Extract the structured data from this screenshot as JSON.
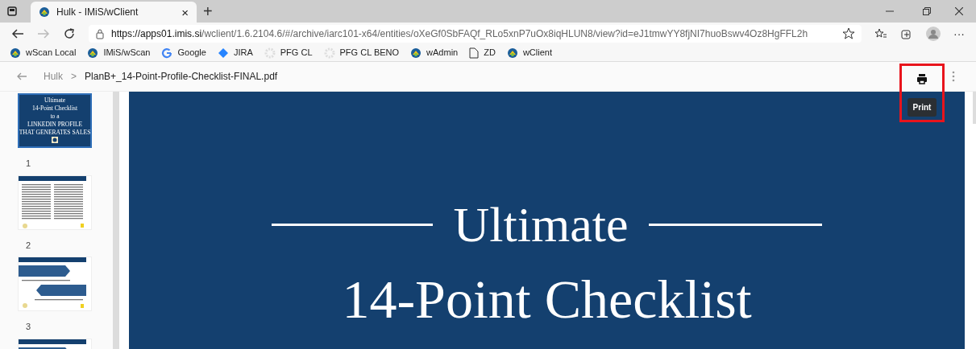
{
  "browser": {
    "tab": {
      "title": "Hulk - IMiS/wClient",
      "close": "×",
      "selected": true
    },
    "new_tab": "+",
    "url_host": "https://apps01.imis.si",
    "url_path": "/wclient/1.6.2104.6/#/archive/iarc101-x64/entities/oXeGf0SbFAQf_RLo5xnP7uOx8iqHLUN8/view?id=eJ1tmwYY8fjNI7huoBswv4Oz8HgFFL2h",
    "menu": "···",
    "bookmarks": [
      {
        "kind": "imis",
        "label": "wScan Local"
      },
      {
        "kind": "imis",
        "label": "IMiS/wScan"
      },
      {
        "kind": "google",
        "label": "Google"
      },
      {
        "kind": "jira",
        "label": "JIRA"
      },
      {
        "kind": "gear",
        "label": "PFG CL"
      },
      {
        "kind": "gear",
        "label": "PFG CL BENO"
      },
      {
        "kind": "imis",
        "label": "wAdmin"
      },
      {
        "kind": "page",
        "label": "ZD"
      },
      {
        "kind": "imis",
        "label": "wClient"
      }
    ]
  },
  "viewer": {
    "breadcrumb": [
      "Hulk",
      "PlanB+_14-Point-Profile-Checklist-FINAL.pdf"
    ],
    "breadcrumb_separator": ">",
    "print_tooltip": "Print",
    "print_highlighted": true,
    "thumbnails": [
      {
        "kind": "cover",
        "selected": true,
        "number": "1",
        "lines": [
          "Ultimate",
          "14-Point Checklist",
          "to a",
          "LINKEDIN PROFILE",
          "THAT GENERATES SALES"
        ]
      },
      {
        "kind": "text",
        "selected": false,
        "number": "2"
      },
      {
        "kind": "steps",
        "selected": false,
        "number": "3"
      },
      {
        "kind": "steps",
        "selected": false
      }
    ],
    "page": {
      "title": "Ultimate",
      "subtitle": "14-Point Checklist"
    }
  }
}
